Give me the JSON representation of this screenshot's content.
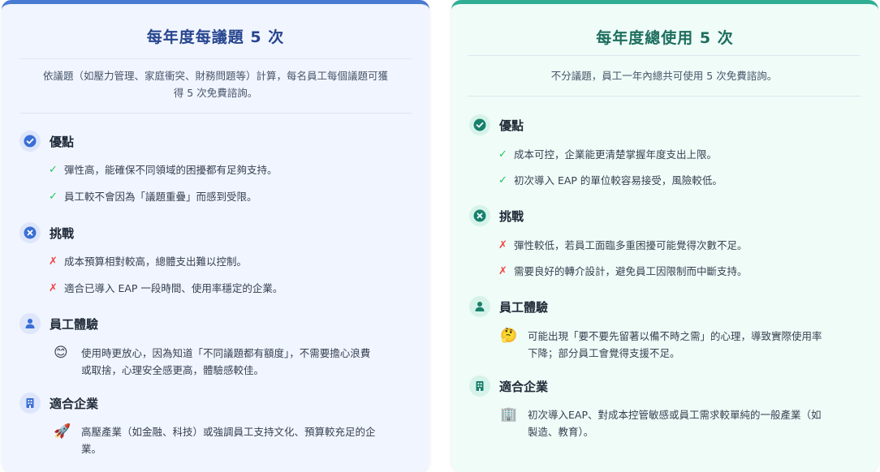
{
  "left": {
    "title": "每年度每議題 5 次",
    "desc_line1": "依議題（如壓力管理、家庭衝突、財務問題等）計算，每名員工每個議題可獲",
    "desc_line2": "得 5 次免費諮詢。",
    "pros": {
      "title": "優點",
      "items": [
        "彈性高，能確保不同領域的困擾都有足夠支持。",
        "員工較不會因為「議題重疊」而感到受限。"
      ]
    },
    "cons": {
      "title": "挑戰",
      "items": [
        "成本預算相對較高，總體支出難以控制。",
        "適合已導入 EAP 一段時間、使用率穩定的企業。"
      ]
    },
    "experience": {
      "title": "員工體驗",
      "emoji": "😊",
      "line1": "使用時更放心，因為知道「不同議題都有額度」，不需要擔心浪費",
      "line2": "或取捨，心理安全感更高，體驗感較佳。"
    },
    "fit": {
      "title": "適合企業",
      "emoji": "🚀",
      "line1": "高壓產業（如金融、科技）或強調員工支持文化、預算較充足的企",
      "line2": "業。"
    }
  },
  "right": {
    "title": "每年度總使用 5 次",
    "desc": "不分議題，員工一年內總共可使用 5 次免費諮詢。",
    "pros": {
      "title": "優點",
      "items": [
        "成本可控，企業能更清楚掌握年度支出上限。",
        "初次導入 EAP 的單位較容易接受，風險較低。"
      ]
    },
    "cons": {
      "title": "挑戰",
      "items": [
        "彈性較低，若員工面臨多重困擾可能覺得次數不足。",
        "需要良好的轉介設計，避免員工因限制而中斷支持。"
      ]
    },
    "experience": {
      "title": "員工體驗",
      "emoji": "🤔",
      "line1": "可能出現「要不要先留著以備不時之需」的心理，導致實際使用率",
      "line2": "下降；部分員工會覺得支援不足。"
    },
    "fit": {
      "title": "適合企業",
      "emoji": "🏢",
      "line1": "初次導入EAP、對成本控管敏感或員工需求較單純的一般產業（如",
      "line2": "製造、教育）。"
    }
  },
  "marks": {
    "check": "✓",
    "cross": "✗"
  },
  "colors": {
    "left_accent": "#4a7bd3",
    "right_accent": "#2fae94"
  }
}
